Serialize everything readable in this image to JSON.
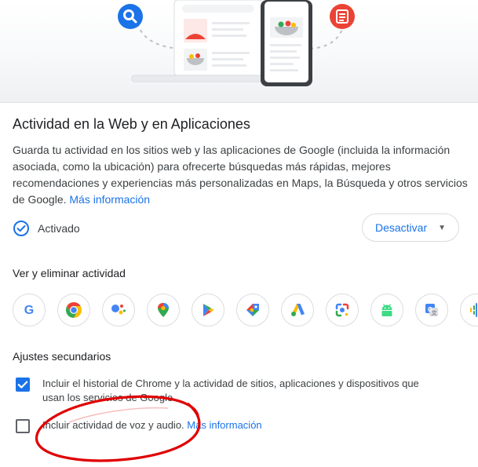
{
  "activity": {
    "title": "Actividad en la Web y en Aplicaciones",
    "description": "Guarda tu actividad en los sitios web y las aplicaciones de Google (incluida la información asociada, como la ubicación) para ofrecerte búsquedas más rápidas, mejores recomendaciones y experiencias más personalizadas en Maps, la Búsqueda y otros servicios de Google.",
    "more_info": "Más información",
    "status": "Activado",
    "deactivate_button": "Desactivar"
  },
  "view_activity": {
    "heading": "Ver y eliminar actividad",
    "apps": [
      "google",
      "chrome",
      "assistant",
      "maps",
      "play",
      "shopping",
      "ads",
      "lens",
      "android",
      "translate",
      "podcasts"
    ]
  },
  "secondary": {
    "heading": "Ajustes secundarios",
    "option1": {
      "checked": true,
      "line1": "Incluir el historial de Chrome y la actividad de sitios, aplicaciones y dispositivos que",
      "line2": "usan los servicios de Google"
    },
    "option2": {
      "checked": false,
      "label": "Incluir actividad de voz y audio.",
      "more_info": "Más información"
    }
  },
  "colors": {
    "accent": "#1a73e8",
    "annotation": "#e00000",
    "search_badge": "#1a73e8",
    "doc_badge": "#ea4335"
  }
}
